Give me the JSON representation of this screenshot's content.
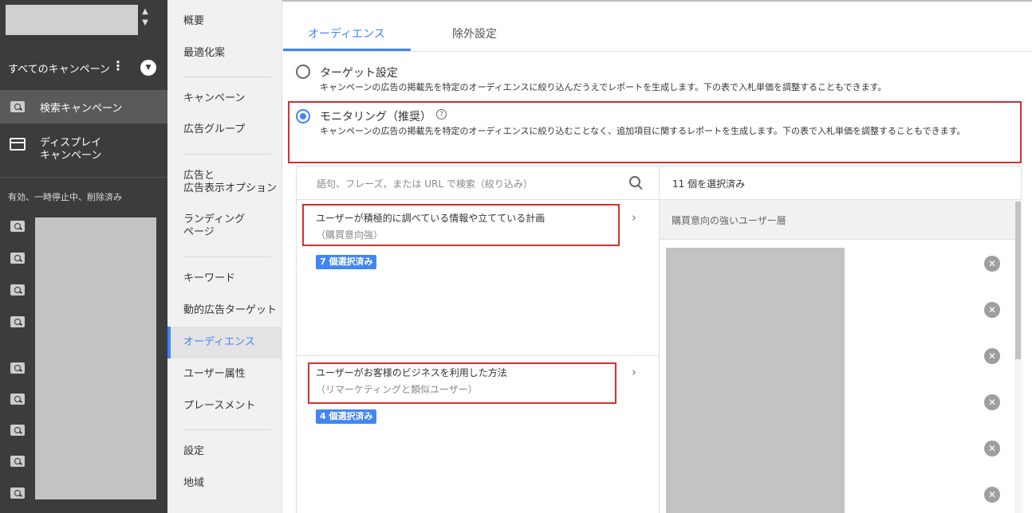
{
  "sidebar": {
    "all_campaigns": "すべてのキャンペーン",
    "search_campaign": "検索キャンペーン",
    "display_campaign_line1": "ディスプレイ",
    "display_campaign_line2": "キャンペーン",
    "status_filter": "有効、一時停止中、削除済み"
  },
  "midnav": {
    "items": [
      "概要",
      "最適化案",
      "キャンペーン",
      "広告グループ",
      "広告と",
      "広告表示オプション",
      "ランディング",
      "ページ",
      "キーワード",
      "動的広告ターゲット",
      "オーディエンス",
      "ユーザー属性",
      "プレースメント",
      "設定",
      "地域"
    ]
  },
  "tabs": {
    "audience": "オーディエンス",
    "exclude": "除外設定"
  },
  "options": {
    "target_title": "ターゲット設定",
    "target_desc": "キャンペーンの広告の掲載先を特定のオーディエンスに絞り込んだうえでレポートを生成します。下の表で入札単価を調整することもできます。",
    "monitor_title": "モニタリング（推奨）",
    "help_icon": "?",
    "monitor_desc": "キャンペーンの広告の掲載先を特定のオーディエンスに絞り込むことなく、追加項目に関するレポートを生成します。下の表で入札単価を調整することもできます。"
  },
  "search": {
    "placeholder": "語句、フレーズ、または URL で検索（絞り込み）"
  },
  "selected": {
    "count_label": "11 個を選択済み",
    "category_header": "購買意向の強いユーザー層"
  },
  "categories": [
    {
      "title": "ユーザーが積極的に調べている情報や立てている計画",
      "subtitle": "（購買意向強）",
      "badge": "7 個選択済み"
    },
    {
      "title": "ユーザーがお客様のビジネスを利用した方法",
      "subtitle": "（リマーケティングと類似ユーザー）",
      "badge": "4 個選択済み"
    }
  ],
  "glyphs": {
    "chevron": "›",
    "close": "✕",
    "kebab": "⋮",
    "dropdown": "▼",
    "updown": "⌃⌄"
  }
}
